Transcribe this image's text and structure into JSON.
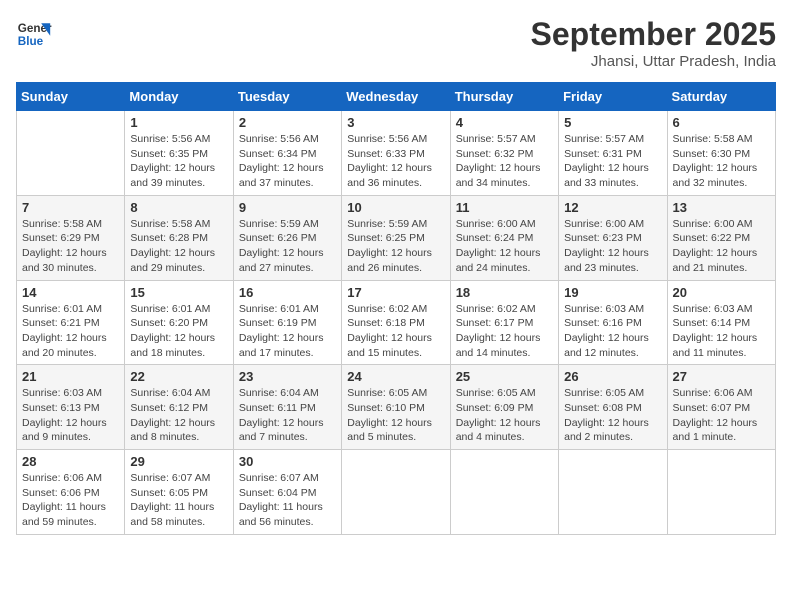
{
  "logo": {
    "line1": "General",
    "line2": "Blue"
  },
  "title": "September 2025",
  "subtitle": "Jhansi, Uttar Pradesh, India",
  "days_header": [
    "Sunday",
    "Monday",
    "Tuesday",
    "Wednesday",
    "Thursday",
    "Friday",
    "Saturday"
  ],
  "weeks": [
    [
      {
        "day": "",
        "sunrise": "",
        "sunset": "",
        "daylight": ""
      },
      {
        "day": "1",
        "sunrise": "Sunrise: 5:56 AM",
        "sunset": "Sunset: 6:35 PM",
        "daylight": "Daylight: 12 hours and 39 minutes."
      },
      {
        "day": "2",
        "sunrise": "Sunrise: 5:56 AM",
        "sunset": "Sunset: 6:34 PM",
        "daylight": "Daylight: 12 hours and 37 minutes."
      },
      {
        "day": "3",
        "sunrise": "Sunrise: 5:56 AM",
        "sunset": "Sunset: 6:33 PM",
        "daylight": "Daylight: 12 hours and 36 minutes."
      },
      {
        "day": "4",
        "sunrise": "Sunrise: 5:57 AM",
        "sunset": "Sunset: 6:32 PM",
        "daylight": "Daylight: 12 hours and 34 minutes."
      },
      {
        "day": "5",
        "sunrise": "Sunrise: 5:57 AM",
        "sunset": "Sunset: 6:31 PM",
        "daylight": "Daylight: 12 hours and 33 minutes."
      },
      {
        "day": "6",
        "sunrise": "Sunrise: 5:58 AM",
        "sunset": "Sunset: 6:30 PM",
        "daylight": "Daylight: 12 hours and 32 minutes."
      }
    ],
    [
      {
        "day": "7",
        "sunrise": "Sunrise: 5:58 AM",
        "sunset": "Sunset: 6:29 PM",
        "daylight": "Daylight: 12 hours and 30 minutes."
      },
      {
        "day": "8",
        "sunrise": "Sunrise: 5:58 AM",
        "sunset": "Sunset: 6:28 PM",
        "daylight": "Daylight: 12 hours and 29 minutes."
      },
      {
        "day": "9",
        "sunrise": "Sunrise: 5:59 AM",
        "sunset": "Sunset: 6:26 PM",
        "daylight": "Daylight: 12 hours and 27 minutes."
      },
      {
        "day": "10",
        "sunrise": "Sunrise: 5:59 AM",
        "sunset": "Sunset: 6:25 PM",
        "daylight": "Daylight: 12 hours and 26 minutes."
      },
      {
        "day": "11",
        "sunrise": "Sunrise: 6:00 AM",
        "sunset": "Sunset: 6:24 PM",
        "daylight": "Daylight: 12 hours and 24 minutes."
      },
      {
        "day": "12",
        "sunrise": "Sunrise: 6:00 AM",
        "sunset": "Sunset: 6:23 PM",
        "daylight": "Daylight: 12 hours and 23 minutes."
      },
      {
        "day": "13",
        "sunrise": "Sunrise: 6:00 AM",
        "sunset": "Sunset: 6:22 PM",
        "daylight": "Daylight: 12 hours and 21 minutes."
      }
    ],
    [
      {
        "day": "14",
        "sunrise": "Sunrise: 6:01 AM",
        "sunset": "Sunset: 6:21 PM",
        "daylight": "Daylight: 12 hours and 20 minutes."
      },
      {
        "day": "15",
        "sunrise": "Sunrise: 6:01 AM",
        "sunset": "Sunset: 6:20 PM",
        "daylight": "Daylight: 12 hours and 18 minutes."
      },
      {
        "day": "16",
        "sunrise": "Sunrise: 6:01 AM",
        "sunset": "Sunset: 6:19 PM",
        "daylight": "Daylight: 12 hours and 17 minutes."
      },
      {
        "day": "17",
        "sunrise": "Sunrise: 6:02 AM",
        "sunset": "Sunset: 6:18 PM",
        "daylight": "Daylight: 12 hours and 15 minutes."
      },
      {
        "day": "18",
        "sunrise": "Sunrise: 6:02 AM",
        "sunset": "Sunset: 6:17 PM",
        "daylight": "Daylight: 12 hours and 14 minutes."
      },
      {
        "day": "19",
        "sunrise": "Sunrise: 6:03 AM",
        "sunset": "Sunset: 6:16 PM",
        "daylight": "Daylight: 12 hours and 12 minutes."
      },
      {
        "day": "20",
        "sunrise": "Sunrise: 6:03 AM",
        "sunset": "Sunset: 6:14 PM",
        "daylight": "Daylight: 12 hours and 11 minutes."
      }
    ],
    [
      {
        "day": "21",
        "sunrise": "Sunrise: 6:03 AM",
        "sunset": "Sunset: 6:13 PM",
        "daylight": "Daylight: 12 hours and 9 minutes."
      },
      {
        "day": "22",
        "sunrise": "Sunrise: 6:04 AM",
        "sunset": "Sunset: 6:12 PM",
        "daylight": "Daylight: 12 hours and 8 minutes."
      },
      {
        "day": "23",
        "sunrise": "Sunrise: 6:04 AM",
        "sunset": "Sunset: 6:11 PM",
        "daylight": "Daylight: 12 hours and 7 minutes."
      },
      {
        "day": "24",
        "sunrise": "Sunrise: 6:05 AM",
        "sunset": "Sunset: 6:10 PM",
        "daylight": "Daylight: 12 hours and 5 minutes."
      },
      {
        "day": "25",
        "sunrise": "Sunrise: 6:05 AM",
        "sunset": "Sunset: 6:09 PM",
        "daylight": "Daylight: 12 hours and 4 minutes."
      },
      {
        "day": "26",
        "sunrise": "Sunrise: 6:05 AM",
        "sunset": "Sunset: 6:08 PM",
        "daylight": "Daylight: 12 hours and 2 minutes."
      },
      {
        "day": "27",
        "sunrise": "Sunrise: 6:06 AM",
        "sunset": "Sunset: 6:07 PM",
        "daylight": "Daylight: 12 hours and 1 minute."
      }
    ],
    [
      {
        "day": "28",
        "sunrise": "Sunrise: 6:06 AM",
        "sunset": "Sunset: 6:06 PM",
        "daylight": "Daylight: 11 hours and 59 minutes."
      },
      {
        "day": "29",
        "sunrise": "Sunrise: 6:07 AM",
        "sunset": "Sunset: 6:05 PM",
        "daylight": "Daylight: 11 hours and 58 minutes."
      },
      {
        "day": "30",
        "sunrise": "Sunrise: 6:07 AM",
        "sunset": "Sunset: 6:04 PM",
        "daylight": "Daylight: 11 hours and 56 minutes."
      },
      {
        "day": "",
        "sunrise": "",
        "sunset": "",
        "daylight": ""
      },
      {
        "day": "",
        "sunrise": "",
        "sunset": "",
        "daylight": ""
      },
      {
        "day": "",
        "sunrise": "",
        "sunset": "",
        "daylight": ""
      },
      {
        "day": "",
        "sunrise": "",
        "sunset": "",
        "daylight": ""
      }
    ]
  ]
}
